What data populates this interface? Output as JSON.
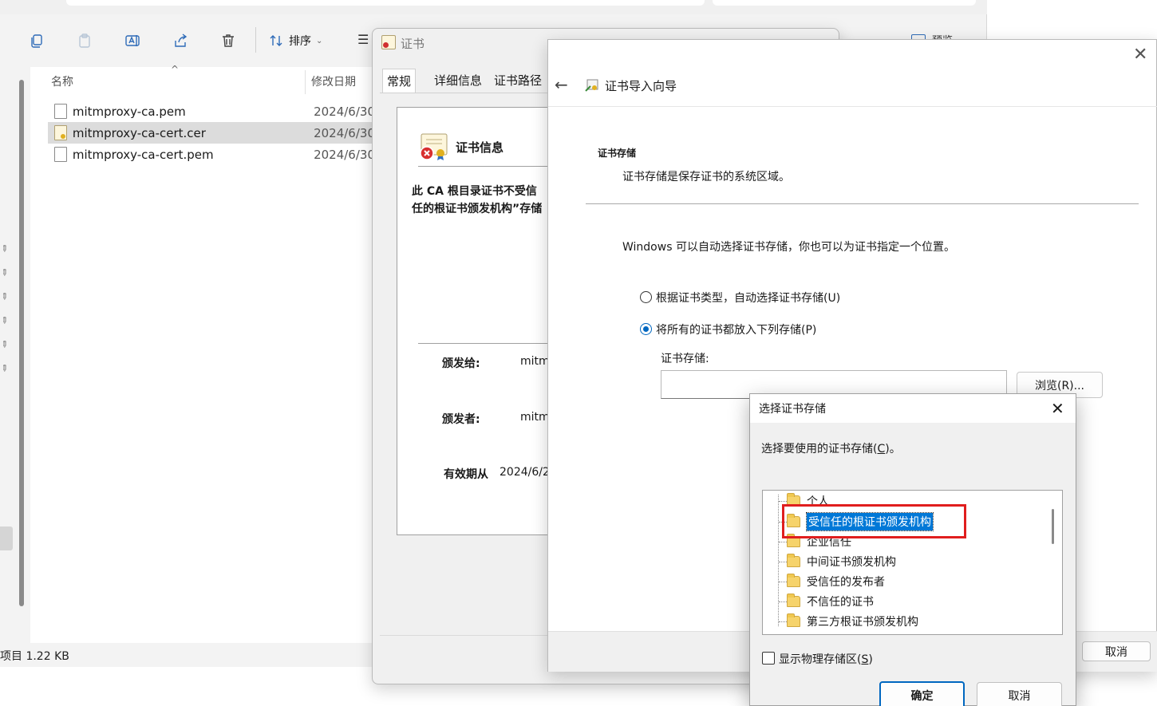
{
  "explorer": {
    "toolbar": {
      "sort_label": "排序",
      "preview_label": "预览"
    },
    "columns": {
      "name": "名称",
      "date": "修改日期"
    },
    "files": [
      {
        "name": "mitmproxy-ca.pem",
        "date": "2024/6/30",
        "type": "file",
        "selected": false
      },
      {
        "name": "mitmproxy-ca-cert.cer",
        "date": "2024/6/30",
        "type": "cert",
        "selected": true
      },
      {
        "name": "mitmproxy-ca-cert.pem",
        "date": "2024/6/30",
        "type": "file",
        "selected": false
      }
    ],
    "status": "项目  1.22 KB"
  },
  "cert_window": {
    "title": "证书",
    "tabs": [
      "常规",
      "详细信息",
      "证书路径"
    ],
    "info_title": "证书信息",
    "warning": [
      "此 CA 根目录证书不受信",
      "任的根证书颁发机构”存储"
    ],
    "issued_to_label": "颁发给:",
    "issued_to_value": "mitm",
    "issued_by_label": "颁发者:",
    "issued_by_value": "mitm",
    "valid_from_label": "有效期从",
    "valid_from_value": "2024/6/2"
  },
  "wizard": {
    "title": "证书导入向导",
    "section_head": "证书存储",
    "section_desc": "证书存储是保存证书的系统区域。",
    "intro": "Windows 可以自动选择证书存储，你也可以为证书指定一个位置。",
    "radio_auto": "根据证书类型，自动选择证书存储(U)",
    "radio_manual": "将所有的证书都放入下列存储(P)",
    "store_label": "证书存储:",
    "store_value": "",
    "browse_label": "浏览(R)...",
    "cancel_label": "取消"
  },
  "select_dialog": {
    "title": "选择证书存储",
    "prompt_pre": "选择要使用的证书存储(",
    "prompt_key": "C",
    "prompt_post": ")。",
    "stores": [
      "个人",
      "受信任的根证书颁发机构",
      "企业信任",
      "中间证书颁发机构",
      "受信任的发布者",
      "不信任的证书",
      "第三方根证书颁发机构"
    ],
    "selected_index": 1,
    "show_physical_pre": "显示物理存储区(",
    "show_physical_key": "S",
    "show_physical_post": ")",
    "ok_label": "确定",
    "cancel_label": "取消"
  },
  "colors": {
    "accent": "#0078d7",
    "highlight_box": "#e01e1e",
    "selection_bg": "#dcdcdc"
  }
}
